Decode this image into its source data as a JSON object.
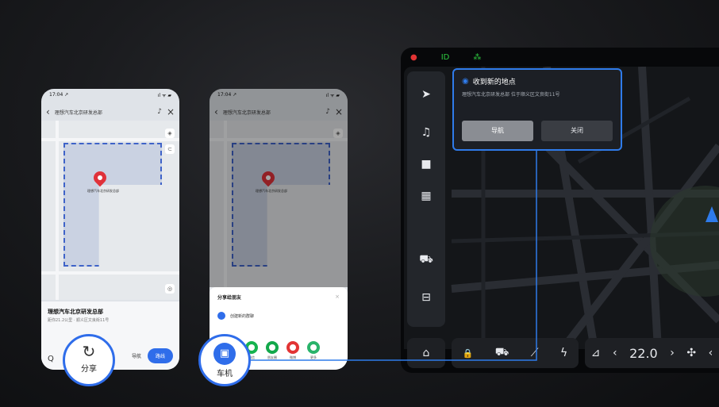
{
  "phone1": {
    "time": "17:04 ↗",
    "signal": "ıl ᯤ ▰",
    "search_text": "理想汽车北京研发总部",
    "pin_label": "理想汽车北京研发总部",
    "place_title": "理想汽车北京研发总部",
    "place_sub": "距你21.2公里 · 顺义区文良街11号",
    "nav_label": "导航",
    "route_label": "路线",
    "quote_icon": "Q"
  },
  "phone2": {
    "time": "17:04 ↗",
    "signal": "ıl ᯤ ▰",
    "search_text": "理想汽车北京研发总部",
    "pin_label": "理想汽车北京研发总部",
    "share_title": "分享给朋友",
    "share_close": "×",
    "create_group": "创建新的群聊",
    "apps": [
      {
        "label": "微信",
        "color": "#17b34f"
      },
      {
        "label": "朋友圈",
        "color": "#13a84b"
      },
      {
        "label": "微博",
        "color": "#e23434"
      },
      {
        "label": "更多",
        "color": "#29b36a"
      }
    ]
  },
  "callouts": {
    "share_icon": "↻",
    "share_label": "分享",
    "car_icon": "▣",
    "car_label": "车机"
  },
  "car": {
    "status_icons": [
      "●",
      "ID",
      "⁂"
    ],
    "status_colors": [
      "#e23434",
      "#2ecc40",
      "#2ecc40"
    ],
    "dock": [
      "➤",
      "♫",
      "■",
      "▦",
      "⛟",
      "⊟"
    ],
    "notification": {
      "title": "收到新的地点",
      "body": "理想汽车北京研发总部   位于顺义区文良街11号",
      "primary": "导航",
      "secondary": "关闭"
    },
    "bottom": {
      "home_icon": "⌂",
      "lock_icon": "🔒",
      "car_icon": "⛟",
      "wiper_icon": "⟋",
      "bolt_icon": "ϟ",
      "seat_icon": "⊿",
      "temp": "22.0",
      "left_arrow": "‹",
      "right_arrow": "›",
      "fan_icon": "✣",
      "extra_arrow": "‹"
    }
  }
}
